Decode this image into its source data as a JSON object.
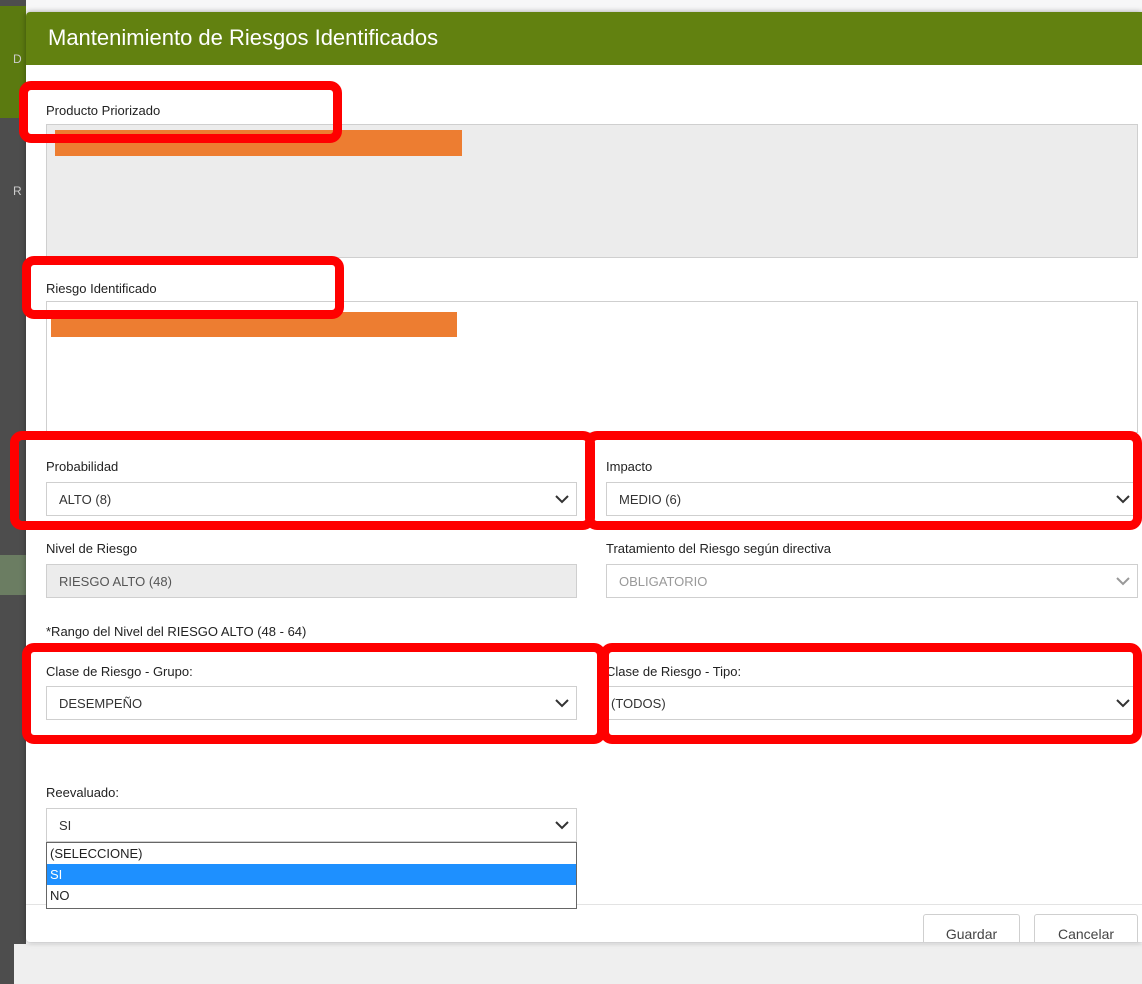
{
  "modal": {
    "title": "Mantenimiento de Riesgos Identificados"
  },
  "producto": {
    "label": "Producto Priorizado",
    "value": ""
  },
  "riesgo": {
    "label": "Riesgo Identificado",
    "value": ""
  },
  "probabilidad": {
    "label": "Probabilidad",
    "value": "ALTO (8)"
  },
  "impacto": {
    "label": "Impacto",
    "value": "MEDIO (6)"
  },
  "nivel": {
    "label": "Nivel de Riesgo",
    "value": "RIESGO ALTO (48)"
  },
  "tratamiento": {
    "label": "Tratamiento del Riesgo según directiva",
    "value": "OBLIGATORIO"
  },
  "rango_note": "*Rango del Nivel del RIESGO ALTO (48 - 64)",
  "clase_grupo": {
    "label": "Clase de Riesgo - Grupo:",
    "value": "DESEMPEÑO"
  },
  "clase_tipo": {
    "label": "Clase de Riesgo - Tipo:",
    "value": "(TODOS)"
  },
  "reevaluado": {
    "label": "Reevaluado:",
    "value": "SI",
    "options": [
      "(SELECCIONE)",
      "SI",
      "NO"
    ],
    "selected_index": 1
  },
  "buttons": {
    "save": "Guardar",
    "cancel": "Cancelar"
  },
  "background": {
    "fragments": [
      "D",
      "R"
    ]
  },
  "colors": {
    "header": "#628110",
    "highlight": "#ff0000",
    "redaction": "#ed7d31",
    "selected_option": "#1e90ff"
  }
}
